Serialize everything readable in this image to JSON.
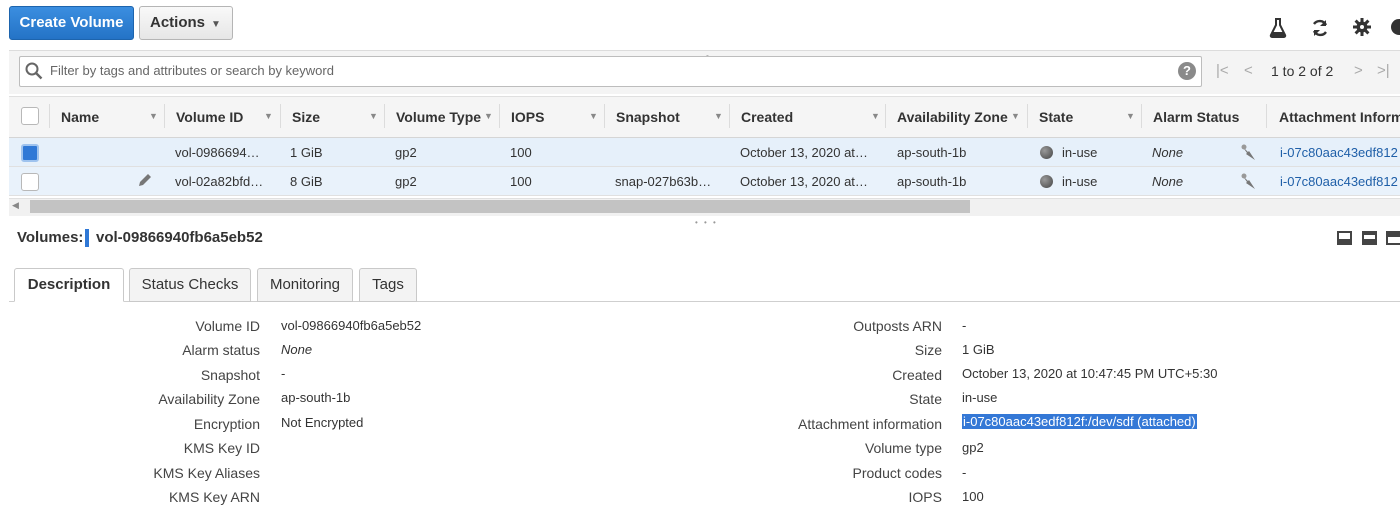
{
  "toolbar": {
    "create_label": "Create Volume",
    "actions_label": "Actions",
    "icons": [
      "flask-icon",
      "refresh-icon",
      "gear-icon",
      "help-icon"
    ]
  },
  "filter": {
    "placeholder": "Filter by tags and attributes or search by keyword",
    "pagination": "1 to 2 of 2"
  },
  "table": {
    "columns": [
      "Name",
      "Volume ID",
      "Size",
      "Volume Type",
      "IOPS",
      "Snapshot",
      "Created",
      "Availability Zone",
      "State",
      "Alarm Status",
      "Attachment Inform"
    ],
    "rows": [
      {
        "selected": true,
        "name": "",
        "volume_id": "vol-0986694…",
        "size": "1 GiB",
        "type": "gp2",
        "iops": "100",
        "snapshot": "",
        "created": "October 13, 2020 at…",
        "az": "ap-south-1b",
        "state": "in-use",
        "alarm": "None",
        "attachment": "i-07c80aac43edf812"
      },
      {
        "selected": false,
        "name": "",
        "volume_id": "vol-02a82bfd…",
        "size": "8 GiB",
        "type": "gp2",
        "iops": "100",
        "snapshot": "snap-027b63b…",
        "created": "October 13, 2020 at…",
        "az": "ap-south-1b",
        "state": "in-use",
        "alarm": "None",
        "attachment": "i-07c80aac43edf812"
      }
    ]
  },
  "detail": {
    "header_label": "Volumes:",
    "volume_id": "vol-09866940fb6a5eb52",
    "tabs": [
      "Description",
      "Status Checks",
      "Monitoring",
      "Tags"
    ],
    "active_tab": "Description",
    "left": [
      {
        "label": "Volume ID",
        "value": "vol-09866940fb6a5eb52"
      },
      {
        "label": "Alarm status",
        "value": "None"
      },
      {
        "label": "Snapshot",
        "value": "-"
      },
      {
        "label": "Availability Zone",
        "value": "ap-south-1b"
      },
      {
        "label": "Encryption",
        "value": "Not Encrypted"
      },
      {
        "label": "KMS Key ID",
        "value": ""
      },
      {
        "label": "KMS Key Aliases",
        "value": ""
      },
      {
        "label": "KMS Key ARN",
        "value": ""
      }
    ],
    "right": [
      {
        "label": "Outposts ARN",
        "value": "-"
      },
      {
        "label": "Size",
        "value": "1 GiB"
      },
      {
        "label": "Created",
        "value": "October 13, 2020 at 10:47:45 PM UTC+5:30"
      },
      {
        "label": "State",
        "value": "in-use"
      },
      {
        "label": "Attachment information",
        "value": "i-07c80aac43edf812f:/dev/sdf (attached)"
      },
      {
        "label": "Volume type",
        "value": "gp2"
      },
      {
        "label": "Product codes",
        "value": "-"
      },
      {
        "label": "IOPS",
        "value": "100"
      }
    ]
  },
  "colors": {
    "primary": "#2473c6",
    "selected_row": "#e6f0fa",
    "highlight": "#3478d6"
  }
}
